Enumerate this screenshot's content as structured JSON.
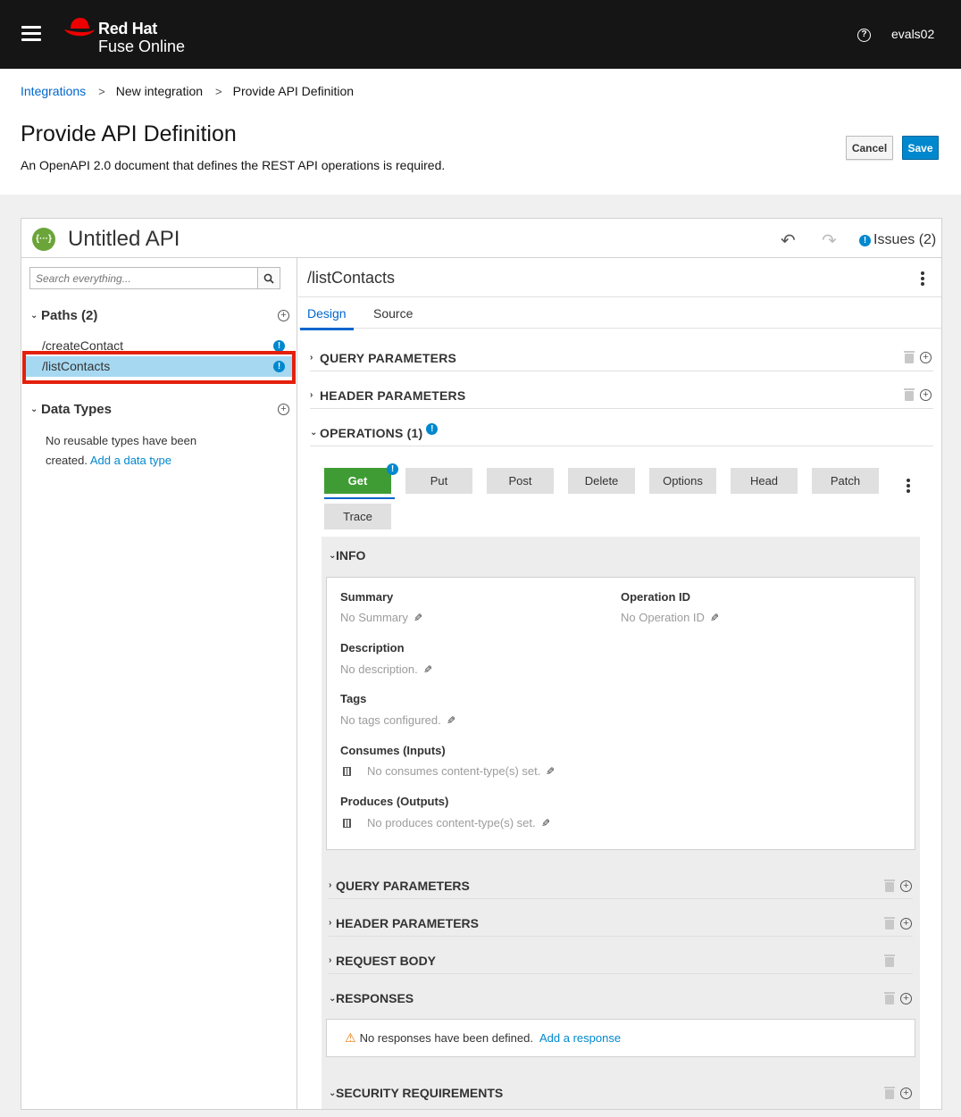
{
  "header": {
    "brand_line1": "Red Hat",
    "brand_line2": "Fuse Online",
    "user": "evals02",
    "help_icon": "?"
  },
  "breadcrumb": [
    "Integrations",
    "New integration",
    "Provide API Definition"
  ],
  "page": {
    "title": "Provide API Definition",
    "subtitle": "An OpenAPI 2.0 document that defines the REST API operations is required.",
    "cancel_label": "Cancel",
    "save_label": "Save"
  },
  "editor": {
    "api_title": "Untitled API",
    "api_icon": "{···}",
    "issues_label": "Issues (2)",
    "search_placeholder": "Search everything...",
    "paths_header": "Paths (2)",
    "paths": [
      "/createContact",
      "/listContacts"
    ],
    "selected_path": "/listContacts",
    "data_types_header": "Data Types",
    "data_types_empty": "No reusable types have been created.",
    "data_types_link": "Add a data type"
  },
  "main": {
    "path_title": "/listContacts",
    "tabs": [
      "Design",
      "Source"
    ],
    "active_tab": "Design",
    "sections": {
      "query": "QUERY PARAMETERS",
      "header": "HEADER PARAMETERS",
      "operations": "OPERATIONS (1)"
    },
    "operations": [
      "Get",
      "Put",
      "Post",
      "Delete",
      "Options",
      "Head",
      "Patch",
      "Trace"
    ],
    "active_operation": "Get",
    "info": {
      "title": "INFO",
      "summary_label": "Summary",
      "summary_value": "No Summary",
      "opid_label": "Operation ID",
      "opid_value": "No Operation ID",
      "desc_label": "Description",
      "desc_value": "No description.",
      "tags_label": "Tags",
      "tags_value": "No tags configured.",
      "consumes_label": "Consumes (Inputs)",
      "consumes_value": "No consumes content-type(s) set.",
      "produces_label": "Produces (Outputs)",
      "produces_value": "No produces content-type(s) set."
    },
    "op_sections": {
      "query": "QUERY PARAMETERS",
      "header": "HEADER PARAMETERS",
      "body": "REQUEST BODY",
      "responses": "RESPONSES",
      "security": "SECURITY REQUIREMENTS"
    },
    "responses_empty": "No responses have been defined.",
    "responses_link": "Add a response"
  },
  "colors": {
    "topbar": "#151515",
    "link": "#0066cc",
    "primary": "#0088ce",
    "get_active": "#3f9c35",
    "selected_row": "#a7d8f1",
    "highlight": "#e3200c"
  }
}
